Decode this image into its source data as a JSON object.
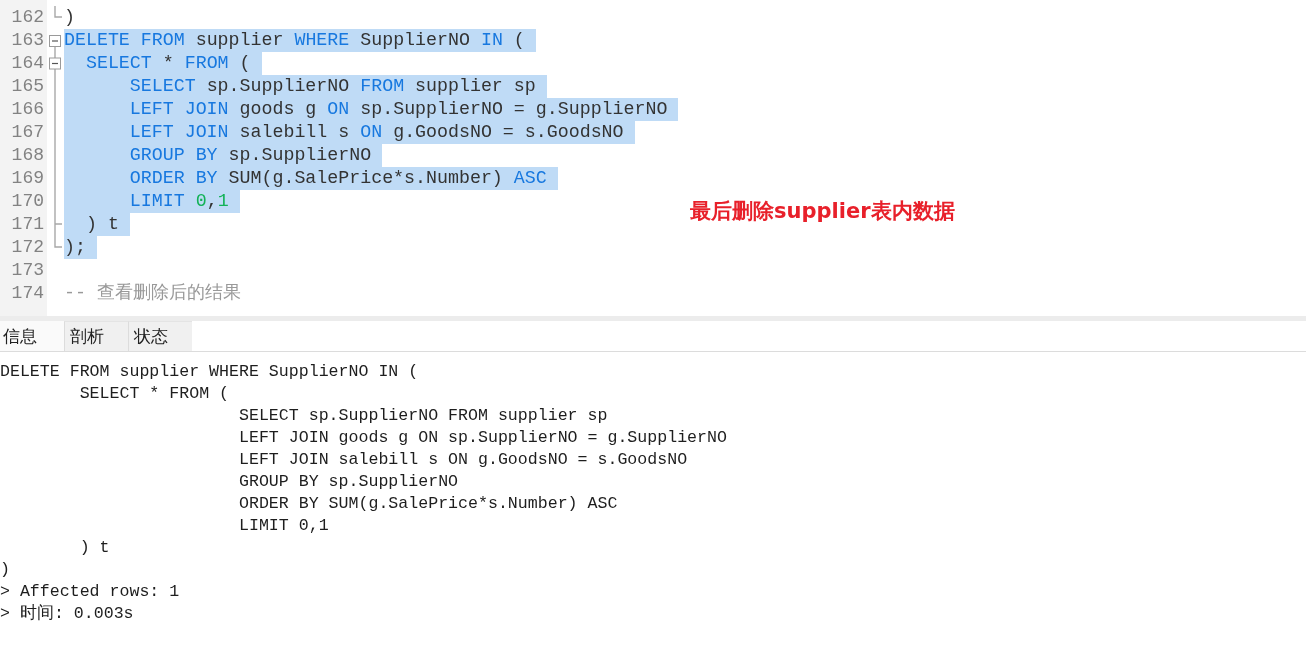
{
  "editor": {
    "lines": [
      {
        "number": "162",
        "kind": "fold_end",
        "selected": false,
        "tokens": [
          {
            "kind": "plain",
            "text": ")"
          }
        ]
      },
      {
        "number": "163",
        "kind": "fold_start",
        "expanded": true,
        "selected": true,
        "tokens": [
          {
            "kind": "keyword",
            "text": "DELETE FROM"
          },
          {
            "kind": "plain",
            "text": " supplier "
          },
          {
            "kind": "keyword",
            "text": "WHERE"
          },
          {
            "kind": "plain",
            "text": " SupplierNO "
          },
          {
            "kind": "keyword",
            "text": "IN"
          },
          {
            "kind": "plain",
            "text": " ("
          }
        ]
      },
      {
        "number": "164",
        "kind": "fold_start_nested",
        "expanded": true,
        "selected": true,
        "tokens": [
          {
            "kind": "keyword",
            "text": "\tSELECT"
          },
          {
            "kind": "plain",
            "text": " * "
          },
          {
            "kind": "keyword",
            "text": "FROM"
          },
          {
            "kind": "plain",
            "text": " ("
          }
        ]
      },
      {
        "number": "165",
        "kind": "fold_body",
        "selected": true,
        "tokens": [
          {
            "kind": "keyword",
            "text": "\t\t\tSELECT"
          },
          {
            "kind": "plain",
            "text": " sp.SupplierNO "
          },
          {
            "kind": "keyword",
            "text": "FROM"
          },
          {
            "kind": "plain",
            "text": " supplier sp"
          }
        ]
      },
      {
        "number": "166",
        "kind": "fold_body",
        "selected": true,
        "tokens": [
          {
            "kind": "keyword",
            "text": "\t\t\tLEFT JOIN"
          },
          {
            "kind": "plain",
            "text": " goods g "
          },
          {
            "kind": "keyword",
            "text": "ON"
          },
          {
            "kind": "plain",
            "text": " sp.SupplierNO = g.SupplierNO"
          }
        ]
      },
      {
        "number": "167",
        "kind": "fold_body",
        "selected": true,
        "tokens": [
          {
            "kind": "keyword",
            "text": "\t\t\tLEFT JOIN"
          },
          {
            "kind": "plain",
            "text": " salebill s "
          },
          {
            "kind": "keyword",
            "text": "ON"
          },
          {
            "kind": "plain",
            "text": " g.GoodsNO = s.GoodsNO"
          }
        ]
      },
      {
        "number": "168",
        "kind": "fold_body",
        "selected": true,
        "tokens": [
          {
            "kind": "keyword",
            "text": "\t\t\tGROUP BY"
          },
          {
            "kind": "plain",
            "text": " sp.SupplierNO"
          }
        ]
      },
      {
        "number": "169",
        "kind": "fold_body",
        "selected": true,
        "tokens": [
          {
            "kind": "keyword",
            "text": "\t\t\tORDER BY"
          },
          {
            "kind": "plain",
            "text": " SUM(g.SalePrice*s.Number) "
          },
          {
            "kind": "keyword",
            "text": "ASC"
          }
        ]
      },
      {
        "number": "170",
        "kind": "fold_body",
        "selected": true,
        "tokens": [
          {
            "kind": "keyword",
            "text": "\t\t\tLIMIT "
          },
          {
            "kind": "number",
            "text": "0"
          },
          {
            "kind": "plain",
            "text": ","
          },
          {
            "kind": "number",
            "text": "1"
          }
        ]
      },
      {
        "number": "171",
        "kind": "fold_end_nested",
        "selected": true,
        "tokens": [
          {
            "kind": "plain",
            "text": "\t) t"
          }
        ]
      },
      {
        "number": "172",
        "kind": "fold_end",
        "selected": true,
        "tokens": [
          {
            "kind": "plain",
            "text": ");"
          }
        ]
      },
      {
        "number": "173",
        "kind": "plain",
        "selected": false
      },
      {
        "number": "174",
        "kind": "plain",
        "selected": false,
        "tokens": [
          {
            "kind": "comment",
            "text": "-- 查看删除后的结果"
          }
        ]
      }
    ]
  },
  "annotation": {
    "text": "最后删除supplier表内数据"
  },
  "result_tabs": [
    {
      "label": "信息",
      "selected": true
    },
    {
      "label": "剖析",
      "selected": false
    },
    {
      "label": "状态",
      "selected": false
    }
  ],
  "output": {
    "lines": [
      "DELETE FROM supplier WHERE SupplierNO IN (",
      "\tSELECT * FROM (",
      "\t\t\tSELECT sp.SupplierNO FROM supplier sp",
      "\t\t\tLEFT JOIN goods g ON sp.SupplierNO = g.SupplierNO",
      "\t\t\tLEFT JOIN salebill s ON g.GoodsNO = s.GoodsNO",
      "\t\t\tGROUP BY sp.SupplierNO",
      "\t\t\tORDER BY SUM(g.SalePrice*s.Number) ASC",
      "\t\t\tLIMIT 0,1",
      "\t) t",
      ")",
      "> Affected rows: 1",
      "> 时间: 0.003s"
    ]
  }
}
